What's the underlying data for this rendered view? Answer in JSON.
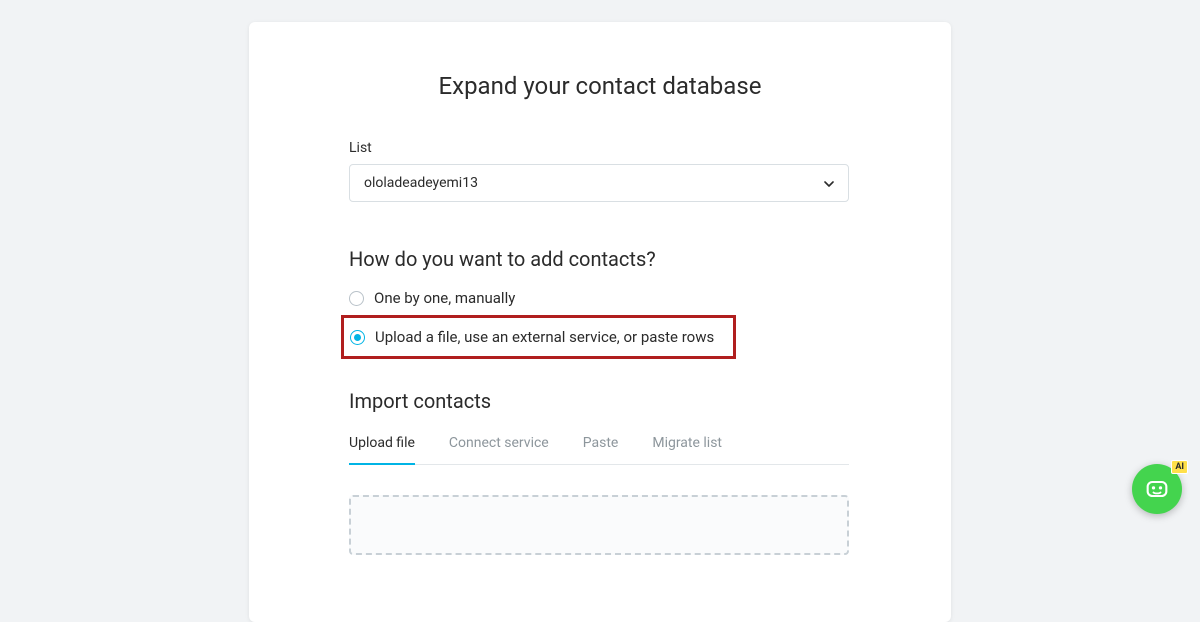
{
  "title": "Expand your contact database",
  "listField": {
    "label": "List",
    "value": "ololadeadeyemi13"
  },
  "question": "How do you want to add contacts?",
  "options": {
    "manual": "One by one, manually",
    "upload": "Upload a file, use an external service, or paste rows"
  },
  "importSection": {
    "title": "Import contacts",
    "tabs": {
      "upload": "Upload file",
      "connect": "Connect service",
      "paste": "Paste",
      "migrate": "Migrate list"
    }
  },
  "chatBadge": "AI"
}
